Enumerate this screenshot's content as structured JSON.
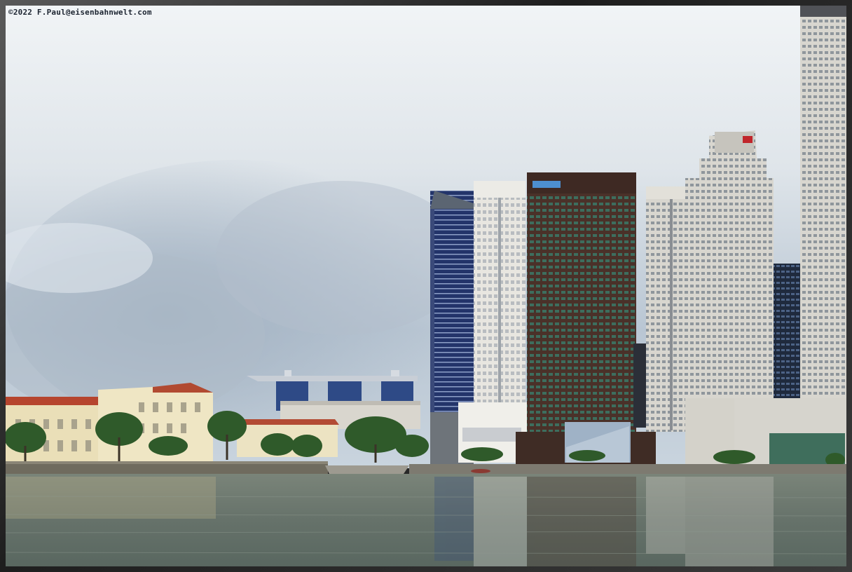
{
  "watermark": {
    "text": "©2022 F.Paul@eisenbahnwelt.com"
  },
  "scene": {
    "subject": "city-skyline-riverfront",
    "colors": {
      "sky_top": "#eef2f5",
      "sky_mid": "#c9d3dd",
      "cloud_dark": "#a9b6c4",
      "water_top": "#6f7a6e",
      "water_bottom": "#5d6a63",
      "tree": "#2f5a2a",
      "frame": "#2b2b2b"
    }
  }
}
